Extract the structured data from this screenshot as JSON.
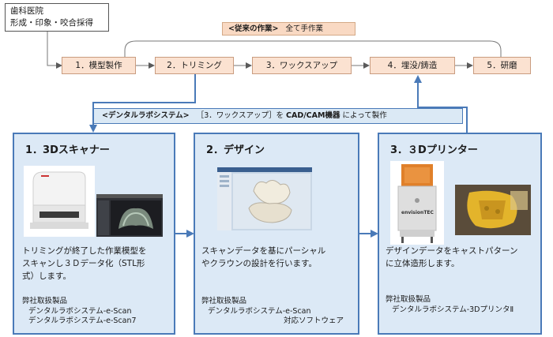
{
  "origin": {
    "line1": "歯科医院",
    "line2": "形成・印象・咬合採得"
  },
  "legacy": {
    "label": "<従来の作業>",
    "note": "全て手作業"
  },
  "steps": [
    "1．模型製作",
    "2．トリミング",
    "3．ワックスアップ",
    "4．埋没/鋳造",
    "5．研磨"
  ],
  "dental_system": {
    "label": "<デンタルラボシステム>",
    "text_a": "［3．ワックスアップ］を",
    "text_b": "CAD/CAM機器",
    "text_c": "によって製作"
  },
  "panels": [
    {
      "title": "1．3Dスキャナー",
      "desc": [
        "トリミングが終了した作業模型を",
        "スキャンし３Ｄデータ化（STL形",
        "式）します。"
      ],
      "products_heading": "弊社取扱製品",
      "products": [
        "デンタルラボシステム-e-Scan",
        "デンタルラボシステム-e-Scan7"
      ]
    },
    {
      "title": "2．デザイン",
      "desc": [
        "スキャンデータを基にパーシャル",
        "やクラウンの設計を行います。"
      ],
      "products_heading": "弊社取扱製品",
      "products": [
        "デンタルラボシステム-e-Scan",
        "対応ソフトウェア"
      ]
    },
    {
      "title": "3．３Dプリンター",
      "desc": [
        "デザインデータをキャストパターン",
        "に立体造形します。"
      ],
      "products_heading": "弊社取扱製品",
      "products": [
        "デンタルラボシステム-3DプリンタⅡ"
      ],
      "printer_brand": "envisionTEC"
    }
  ]
}
